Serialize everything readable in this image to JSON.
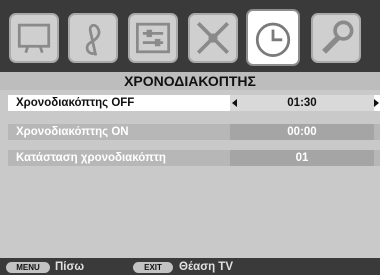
{
  "menu": {
    "tabs": [
      {
        "icon": "picture-icon"
      },
      {
        "icon": "sound-icon"
      },
      {
        "icon": "channel-icon"
      },
      {
        "icon": "features-icon"
      },
      {
        "icon": "timer-clock-icon",
        "active": true
      },
      {
        "icon": "setup-wrench-icon"
      }
    ],
    "title": "ΧΡΟΝΟΔΙΑΚΟΠΤΗΣ",
    "rows": [
      {
        "label": "Χρονοδιακόπτης OFF",
        "value": "01:30",
        "selected": true
      },
      {
        "label": "Χρονοδιακόπτης ON",
        "value": "00:00",
        "selected": false
      },
      {
        "label": "Κατάσταση χρονοδιακόπτη",
        "value": "01",
        "selected": false
      }
    ]
  },
  "footer": {
    "menu_key": "MENU",
    "menu_hint": "Πίσω",
    "exit_key": "EXIT",
    "exit_hint": "Θέαση TV"
  },
  "colors": {
    "panel": "#c9c9c9",
    "top_bar": "#3a3a3a",
    "selected_row": "#ffffff"
  }
}
